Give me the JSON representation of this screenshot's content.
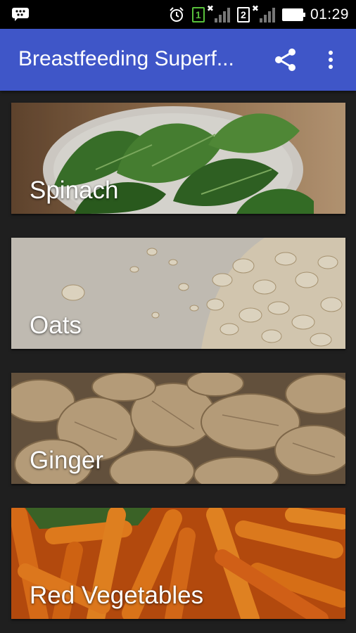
{
  "status_bar": {
    "time": "01:29",
    "sim1_label": "1",
    "sim2_label": "2",
    "icons": [
      "bbm-icon",
      "alarm-icon",
      "signal-icon",
      "battery-icon"
    ]
  },
  "app_bar": {
    "title": "Breastfeeding Superf...",
    "color": "#3f56c8",
    "actions": [
      "share-icon",
      "more-vert-icon"
    ]
  },
  "foods": [
    {
      "label": "Spinach"
    },
    {
      "label": "Oats"
    },
    {
      "label": "Ginger"
    },
    {
      "label": "Red Vegetables"
    }
  ]
}
